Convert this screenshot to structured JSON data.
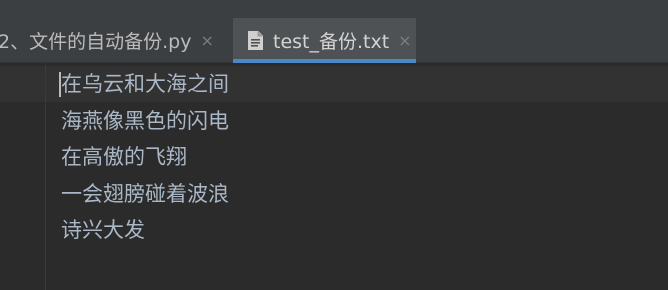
{
  "tabs": [
    {
      "label": "2、文件的自动备份.py",
      "close": "×",
      "active": false
    },
    {
      "label": "test_备份.txt",
      "close": "×",
      "active": true,
      "icon": "text-file-icon"
    }
  ],
  "editor": {
    "lines": [
      "在乌云和大海之间",
      "海燕像黑色的闪电",
      "在高傲的飞翔",
      "一会翅膀碰着波浪",
      "诗兴大发"
    ]
  },
  "colors": {
    "tabbar_bg": "#3c3f41",
    "active_tab_bg": "#4e5254",
    "active_tab_underline": "#4a88c7",
    "editor_bg": "#2b2b2b",
    "text": "#a9b7c6"
  }
}
